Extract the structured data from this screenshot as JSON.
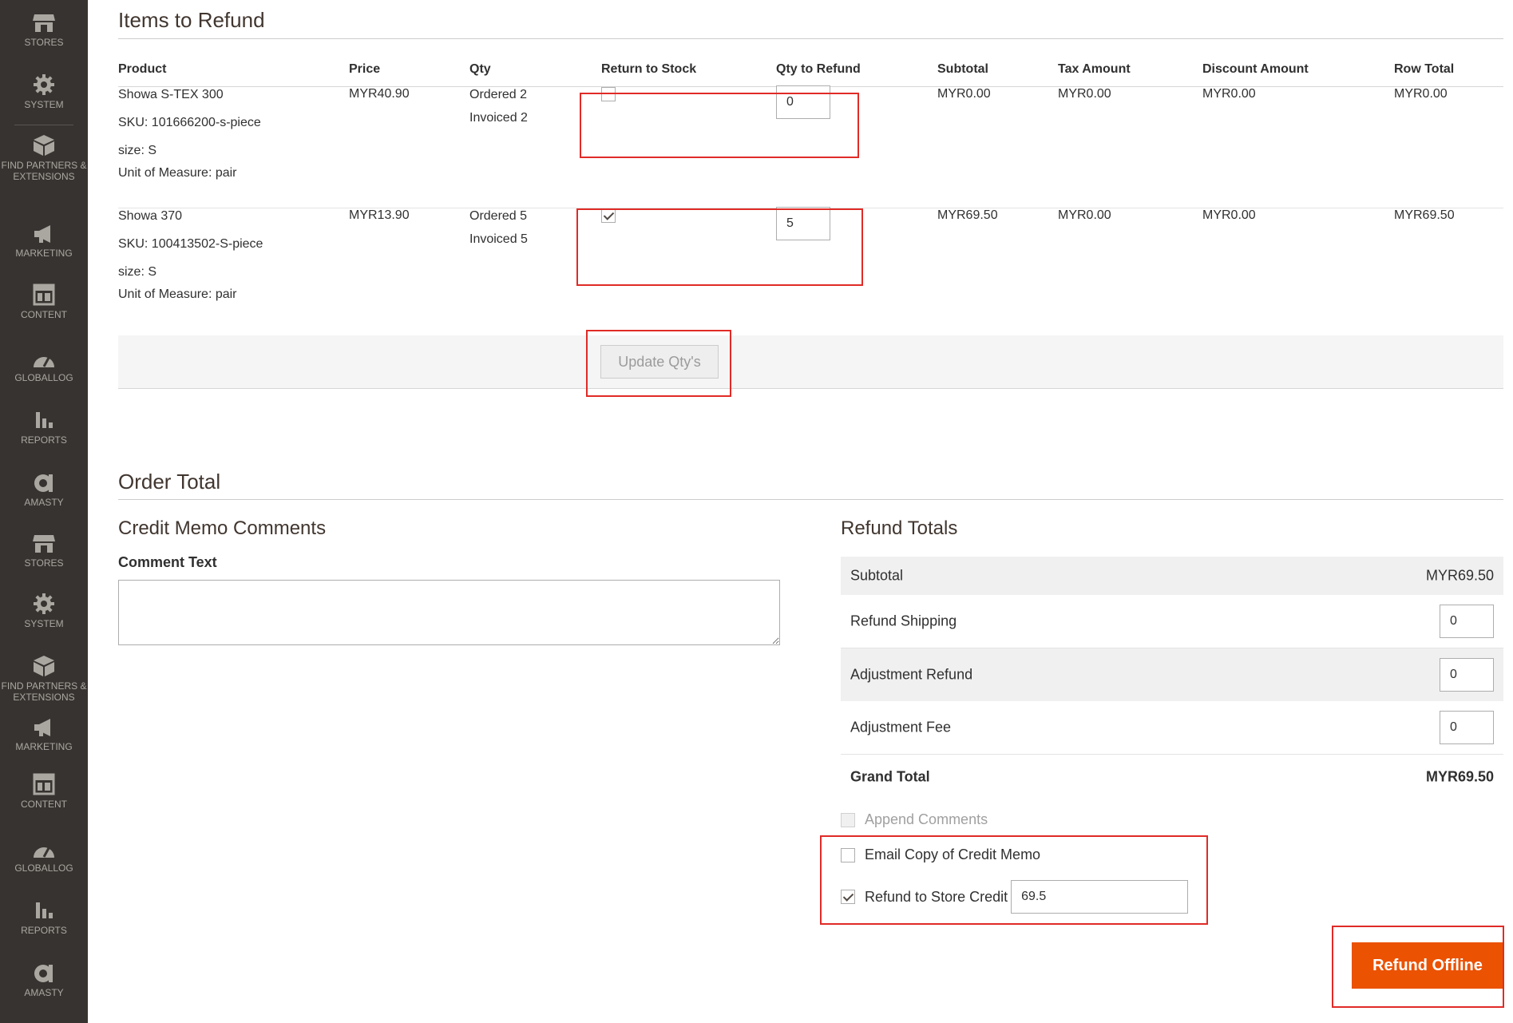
{
  "sidebar": {
    "items": [
      {
        "label": "STORES",
        "icon": "store-icon"
      },
      {
        "label": "SYSTEM",
        "icon": "gear-icon"
      },
      {
        "label": "FIND PARTNERS & EXTENSIONS",
        "icon": "cubes-icon"
      },
      {
        "label": "MARKETING",
        "icon": "megaphone-icon"
      },
      {
        "label": "CONTENT",
        "icon": "layout-icon"
      },
      {
        "label": "GLOBALLOG",
        "icon": "speedometer-icon"
      },
      {
        "label": "REPORTS",
        "icon": "bar-chart-icon"
      },
      {
        "label": "AMASTY",
        "icon": "amasty-logo-icon"
      },
      {
        "label": "STORES",
        "icon": "store-icon"
      },
      {
        "label": "SYSTEM",
        "icon": "gear-icon"
      },
      {
        "label": "FIND PARTNERS & EXTENSIONS",
        "icon": "cubes-icon"
      },
      {
        "label": "MARKETING",
        "icon": "megaphone-icon"
      },
      {
        "label": "CONTENT",
        "icon": "layout-icon"
      },
      {
        "label": "GLOBALLOG",
        "icon": "speedometer-icon"
      },
      {
        "label": "REPORTS",
        "icon": "bar-chart-icon"
      },
      {
        "label": "AMASTY",
        "icon": "amasty-logo-icon"
      }
    ]
  },
  "items_section": {
    "title": "Items to Refund",
    "columns": [
      "Product",
      "Price",
      "Qty",
      "Return to Stock",
      "Qty to Refund",
      "Subtotal",
      "Tax Amount",
      "Discount Amount",
      "Row Total"
    ],
    "rows": [
      {
        "name": "Showa S-TEX 300",
        "sku": "SKU: 101666200-s-piece",
        "size": "size: S",
        "uom": "Unit of Measure: pair",
        "price": "MYR40.90",
        "ordered": "Ordered 2",
        "invoiced": "Invoiced 2",
        "return_to_stock": false,
        "qty_to_refund": "0",
        "subtotal": "MYR0.00",
        "tax": "MYR0.00",
        "discount": "MYR0.00",
        "row_total": "MYR0.00"
      },
      {
        "name": "Showa 370",
        "sku": "SKU: 100413502-S-piece",
        "size": "size: S",
        "uom": "Unit of Measure: pair",
        "price": "MYR13.90",
        "ordered": "Ordered 5",
        "invoiced": "Invoiced 5",
        "return_to_stock": true,
        "qty_to_refund": "5",
        "subtotal": "MYR69.50",
        "tax": "MYR0.00",
        "discount": "MYR0.00",
        "row_total": "MYR69.50"
      }
    ],
    "update_button": "Update Qty's"
  },
  "order_total": {
    "title": "Order Total",
    "comments_title": "Credit Memo Comments",
    "comment_label": "Comment Text",
    "comment_value": ""
  },
  "refund_totals": {
    "title": "Refund Totals",
    "subtotal_label": "Subtotal",
    "subtotal_value": "MYR69.50",
    "refund_shipping_label": "Refund Shipping",
    "refund_shipping_value": "0",
    "adjustment_refund_label": "Adjustment Refund",
    "adjustment_refund_value": "0",
    "adjustment_fee_label": "Adjustment Fee",
    "adjustment_fee_value": "0",
    "grand_total_label": "Grand Total",
    "grand_total_value": "MYR69.50"
  },
  "options": {
    "append_comments": "Append Comments",
    "email_copy": "Email Copy of Credit Memo",
    "refund_store_credit": "Refund to Store Credit",
    "store_credit_value": "69.5"
  },
  "refund_offline_button": "Refund Offline",
  "colors": {
    "sidebar_bg": "#373330",
    "accent_orange": "#eb5202",
    "highlight_red": "#e02b27"
  }
}
